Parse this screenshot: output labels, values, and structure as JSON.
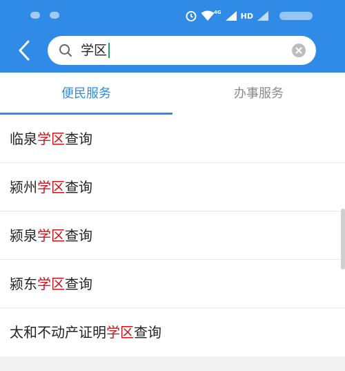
{
  "header": {
    "search": {
      "value": "学区",
      "back_icon": "chevron-left-icon",
      "search_icon": "search-icon",
      "clear_icon": "clear-icon"
    }
  },
  "status_bar": {
    "network_label": "4G",
    "hd_label": "HD"
  },
  "tabs": [
    {
      "label": "便民服务",
      "active": true
    },
    {
      "label": "办事服务",
      "active": false
    }
  ],
  "results": [
    {
      "pre": "临泉",
      "hl": "学区",
      "post": "查询"
    },
    {
      "pre": "颍州",
      "hl": "学区",
      "post": "查询"
    },
    {
      "pre": "颍泉",
      "hl": "学区",
      "post": "查询"
    },
    {
      "pre": "颍东",
      "hl": "学区",
      "post": "查询"
    },
    {
      "pre": "太和不动产证明",
      "hl": "学区",
      "post": "查询"
    }
  ],
  "colors": {
    "accent": "#2f8be6",
    "highlight": "#d0121b"
  }
}
